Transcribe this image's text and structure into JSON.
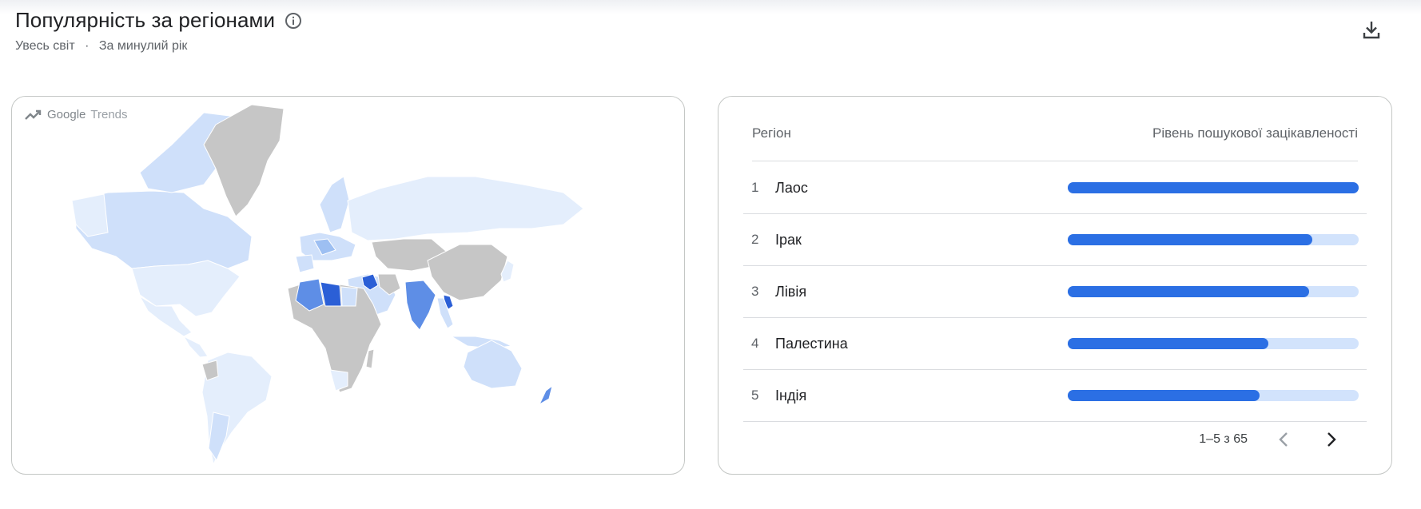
{
  "header": {
    "title": "Популярність за регіонами",
    "scope": "Увесь світ",
    "separator": "·",
    "period": "За минулий рік"
  },
  "map": {
    "logo_word1": "Google",
    "logo_word2": "Trends",
    "colors": {
      "no_data": "#c6c6c6",
      "low": "#e4eefc",
      "mid_low": "#cfe0fa",
      "mid": "#9dbff2",
      "high": "#5e8ee6",
      "top": "#2b5fd6"
    }
  },
  "table": {
    "col_region": "Регіон",
    "col_interest": "Рівень пошукової зацікавленості",
    "rows": [
      {
        "rank": "1",
        "region": "Лаос",
        "value": 100
      },
      {
        "rank": "2",
        "region": "Ірак",
        "value": 84
      },
      {
        "rank": "3",
        "region": "Лівія",
        "value": 83
      },
      {
        "rank": "4",
        "region": "Палестина",
        "value": 69
      },
      {
        "rank": "5",
        "region": "Індія",
        "value": 66
      }
    ],
    "pagination": "1–5 з 65"
  }
}
